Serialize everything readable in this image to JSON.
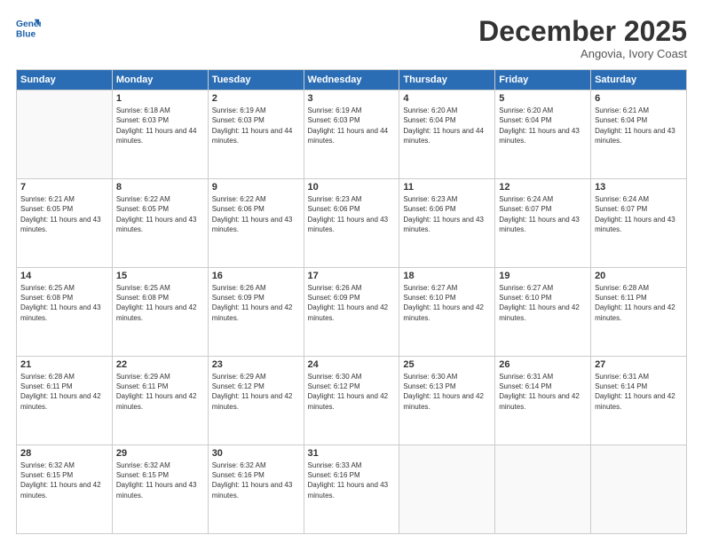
{
  "header": {
    "logo_line1": "General",
    "logo_line2": "Blue",
    "month": "December 2025",
    "location": "Angovia, Ivory Coast"
  },
  "weekdays": [
    "Sunday",
    "Monday",
    "Tuesday",
    "Wednesday",
    "Thursday",
    "Friday",
    "Saturday"
  ],
  "weeks": [
    [
      {
        "day": "",
        "sunrise": "",
        "sunset": "",
        "daylight": ""
      },
      {
        "day": "1",
        "sunrise": "Sunrise: 6:18 AM",
        "sunset": "Sunset: 6:03 PM",
        "daylight": "Daylight: 11 hours and 44 minutes."
      },
      {
        "day": "2",
        "sunrise": "Sunrise: 6:19 AM",
        "sunset": "Sunset: 6:03 PM",
        "daylight": "Daylight: 11 hours and 44 minutes."
      },
      {
        "day": "3",
        "sunrise": "Sunrise: 6:19 AM",
        "sunset": "Sunset: 6:03 PM",
        "daylight": "Daylight: 11 hours and 44 minutes."
      },
      {
        "day": "4",
        "sunrise": "Sunrise: 6:20 AM",
        "sunset": "Sunset: 6:04 PM",
        "daylight": "Daylight: 11 hours and 44 minutes."
      },
      {
        "day": "5",
        "sunrise": "Sunrise: 6:20 AM",
        "sunset": "Sunset: 6:04 PM",
        "daylight": "Daylight: 11 hours and 43 minutes."
      },
      {
        "day": "6",
        "sunrise": "Sunrise: 6:21 AM",
        "sunset": "Sunset: 6:04 PM",
        "daylight": "Daylight: 11 hours and 43 minutes."
      }
    ],
    [
      {
        "day": "7",
        "sunrise": "Sunrise: 6:21 AM",
        "sunset": "Sunset: 6:05 PM",
        "daylight": "Daylight: 11 hours and 43 minutes."
      },
      {
        "day": "8",
        "sunrise": "Sunrise: 6:22 AM",
        "sunset": "Sunset: 6:05 PM",
        "daylight": "Daylight: 11 hours and 43 minutes."
      },
      {
        "day": "9",
        "sunrise": "Sunrise: 6:22 AM",
        "sunset": "Sunset: 6:06 PM",
        "daylight": "Daylight: 11 hours and 43 minutes."
      },
      {
        "day": "10",
        "sunrise": "Sunrise: 6:23 AM",
        "sunset": "Sunset: 6:06 PM",
        "daylight": "Daylight: 11 hours and 43 minutes."
      },
      {
        "day": "11",
        "sunrise": "Sunrise: 6:23 AM",
        "sunset": "Sunset: 6:06 PM",
        "daylight": "Daylight: 11 hours and 43 minutes."
      },
      {
        "day": "12",
        "sunrise": "Sunrise: 6:24 AM",
        "sunset": "Sunset: 6:07 PM",
        "daylight": "Daylight: 11 hours and 43 minutes."
      },
      {
        "day": "13",
        "sunrise": "Sunrise: 6:24 AM",
        "sunset": "Sunset: 6:07 PM",
        "daylight": "Daylight: 11 hours and 43 minutes."
      }
    ],
    [
      {
        "day": "14",
        "sunrise": "Sunrise: 6:25 AM",
        "sunset": "Sunset: 6:08 PM",
        "daylight": "Daylight: 11 hours and 43 minutes."
      },
      {
        "day": "15",
        "sunrise": "Sunrise: 6:25 AM",
        "sunset": "Sunset: 6:08 PM",
        "daylight": "Daylight: 11 hours and 42 minutes."
      },
      {
        "day": "16",
        "sunrise": "Sunrise: 6:26 AM",
        "sunset": "Sunset: 6:09 PM",
        "daylight": "Daylight: 11 hours and 42 minutes."
      },
      {
        "day": "17",
        "sunrise": "Sunrise: 6:26 AM",
        "sunset": "Sunset: 6:09 PM",
        "daylight": "Daylight: 11 hours and 42 minutes."
      },
      {
        "day": "18",
        "sunrise": "Sunrise: 6:27 AM",
        "sunset": "Sunset: 6:10 PM",
        "daylight": "Daylight: 11 hours and 42 minutes."
      },
      {
        "day": "19",
        "sunrise": "Sunrise: 6:27 AM",
        "sunset": "Sunset: 6:10 PM",
        "daylight": "Daylight: 11 hours and 42 minutes."
      },
      {
        "day": "20",
        "sunrise": "Sunrise: 6:28 AM",
        "sunset": "Sunset: 6:11 PM",
        "daylight": "Daylight: 11 hours and 42 minutes."
      }
    ],
    [
      {
        "day": "21",
        "sunrise": "Sunrise: 6:28 AM",
        "sunset": "Sunset: 6:11 PM",
        "daylight": "Daylight: 11 hours and 42 minutes."
      },
      {
        "day": "22",
        "sunrise": "Sunrise: 6:29 AM",
        "sunset": "Sunset: 6:11 PM",
        "daylight": "Daylight: 11 hours and 42 minutes."
      },
      {
        "day": "23",
        "sunrise": "Sunrise: 6:29 AM",
        "sunset": "Sunset: 6:12 PM",
        "daylight": "Daylight: 11 hours and 42 minutes."
      },
      {
        "day": "24",
        "sunrise": "Sunrise: 6:30 AM",
        "sunset": "Sunset: 6:12 PM",
        "daylight": "Daylight: 11 hours and 42 minutes."
      },
      {
        "day": "25",
        "sunrise": "Sunrise: 6:30 AM",
        "sunset": "Sunset: 6:13 PM",
        "daylight": "Daylight: 11 hours and 42 minutes."
      },
      {
        "day": "26",
        "sunrise": "Sunrise: 6:31 AM",
        "sunset": "Sunset: 6:14 PM",
        "daylight": "Daylight: 11 hours and 42 minutes."
      },
      {
        "day": "27",
        "sunrise": "Sunrise: 6:31 AM",
        "sunset": "Sunset: 6:14 PM",
        "daylight": "Daylight: 11 hours and 42 minutes."
      }
    ],
    [
      {
        "day": "28",
        "sunrise": "Sunrise: 6:32 AM",
        "sunset": "Sunset: 6:15 PM",
        "daylight": "Daylight: 11 hours and 42 minutes."
      },
      {
        "day": "29",
        "sunrise": "Sunrise: 6:32 AM",
        "sunset": "Sunset: 6:15 PM",
        "daylight": "Daylight: 11 hours and 43 minutes."
      },
      {
        "day": "30",
        "sunrise": "Sunrise: 6:32 AM",
        "sunset": "Sunset: 6:16 PM",
        "daylight": "Daylight: 11 hours and 43 minutes."
      },
      {
        "day": "31",
        "sunrise": "Sunrise: 6:33 AM",
        "sunset": "Sunset: 6:16 PM",
        "daylight": "Daylight: 11 hours and 43 minutes."
      },
      {
        "day": "",
        "sunrise": "",
        "sunset": "",
        "daylight": ""
      },
      {
        "day": "",
        "sunrise": "",
        "sunset": "",
        "daylight": ""
      },
      {
        "day": "",
        "sunrise": "",
        "sunset": "",
        "daylight": ""
      }
    ]
  ]
}
